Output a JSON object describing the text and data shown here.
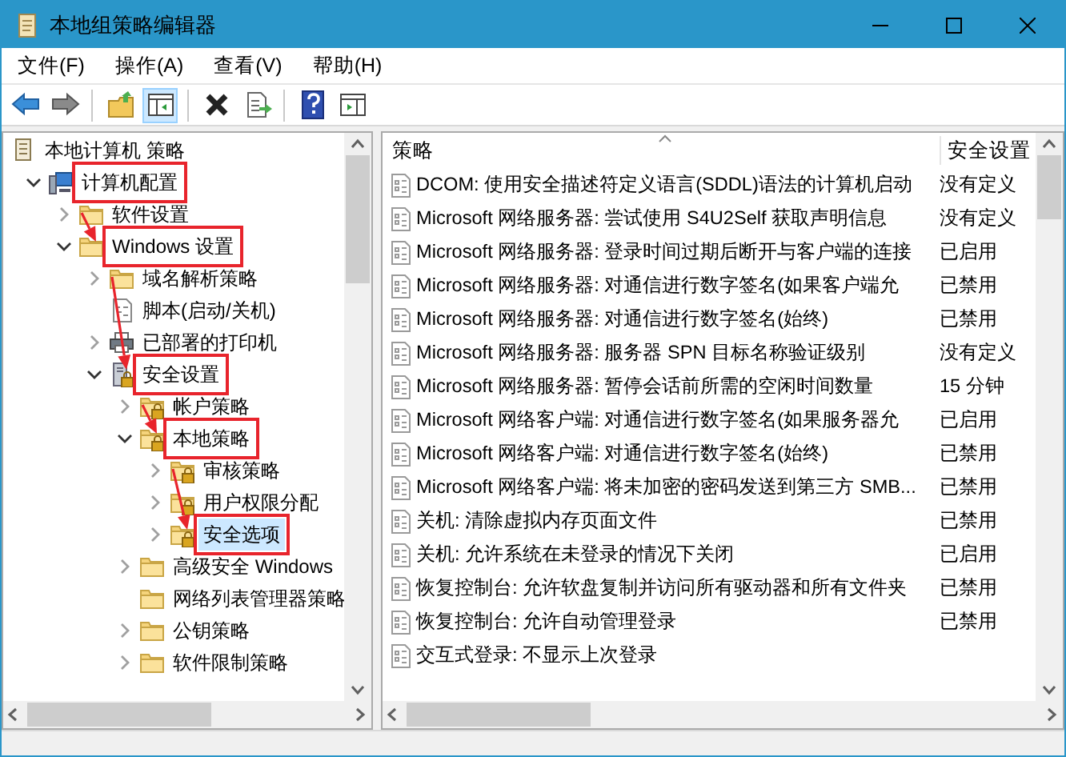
{
  "window": {
    "title": "本地组策略编辑器"
  },
  "menu": [
    "文件(F)",
    "操作(A)",
    "查看(V)",
    "帮助(H)"
  ],
  "toolbar": [
    {
      "kind": "back",
      "pressed": false
    },
    {
      "kind": "forward",
      "pressed": false
    },
    {
      "kind": "sep"
    },
    {
      "kind": "up",
      "pressed": false
    },
    {
      "kind": "tree",
      "pressed": true
    },
    {
      "kind": "sep"
    },
    {
      "kind": "delete",
      "pressed": false
    },
    {
      "kind": "export",
      "pressed": false
    },
    {
      "kind": "sep"
    },
    {
      "kind": "help",
      "pressed": false
    },
    {
      "kind": "pane",
      "pressed": false
    }
  ],
  "tree": [
    {
      "label": "本地计算机 策略",
      "kind": "doc",
      "selected": false,
      "annotated": false,
      "children": [
        {
          "label": "计算机配置",
          "kind": "computer",
          "expanded": true,
          "selected": false,
          "annotated": true,
          "children": [
            {
              "label": "软件设置",
              "kind": "folder",
              "expanded": false,
              "selected": false,
              "annotated": false
            },
            {
              "label": "Windows 设置",
              "kind": "folder",
              "expanded": true,
              "selected": false,
              "annotated": true,
              "children": [
                {
                  "label": "域名解析策略",
                  "kind": "folder",
                  "expanded": false,
                  "selected": false,
                  "annotated": false
                },
                {
                  "label": "脚本(启动/关机)",
                  "kind": "script",
                  "selected": false,
                  "annotated": false
                },
                {
                  "label": "已部署的打印机",
                  "kind": "printer",
                  "expanded": false,
                  "selected": false,
                  "annotated": false
                },
                {
                  "label": "安全设置",
                  "kind": "security",
                  "expanded": true,
                  "selected": false,
                  "annotated": true,
                  "children": [
                    {
                      "label": "帐户策略",
                      "kind": "lockfolder",
                      "expanded": false,
                      "selected": false,
                      "annotated": false
                    },
                    {
                      "label": "本地策略",
                      "kind": "lockfolder",
                      "expanded": true,
                      "selected": false,
                      "annotated": true,
                      "children": [
                        {
                          "label": "审核策略",
                          "kind": "lockfolder",
                          "expanded": false,
                          "selected": false,
                          "annotated": false
                        },
                        {
                          "label": "用户权限分配",
                          "kind": "lockfolder",
                          "expanded": false,
                          "selected": false,
                          "annotated": false
                        },
                        {
                          "label": "安全选项",
                          "kind": "lockfolder",
                          "expanded": false,
                          "selected": true,
                          "annotated": true
                        }
                      ]
                    },
                    {
                      "label": "高级安全 Windows",
                      "kind": "folder",
                      "expanded": false,
                      "selected": false,
                      "annotated": false
                    },
                    {
                      "label": "网络列表管理器策略",
                      "kind": "folder",
                      "selected": false,
                      "annotated": false
                    },
                    {
                      "label": "公钥策略",
                      "kind": "folder",
                      "expanded": false,
                      "selected": false,
                      "annotated": false
                    },
                    {
                      "label": "软件限制策略",
                      "kind": "folder",
                      "expanded": false,
                      "selected": false,
                      "annotated": false
                    }
                  ]
                }
              ]
            }
          ]
        }
      ]
    }
  ],
  "table": {
    "columns": [
      {
        "label": "策略",
        "sorted": true
      },
      {
        "label": "安全设置",
        "sorted": false
      }
    ],
    "rows": [
      {
        "policy": "DCOM: 使用安全描述符定义语言(SDDL)语法的计算机启动",
        "setting": "没有定义"
      },
      {
        "policy": "Microsoft 网络服务器: 尝试使用 S4U2Self 获取声明信息",
        "setting": "没有定义"
      },
      {
        "policy": "Microsoft 网络服务器: 登录时间过期后断开与客户端的连接",
        "setting": "已启用"
      },
      {
        "policy": "Microsoft 网络服务器: 对通信进行数字签名(如果客户端允",
        "setting": "已禁用"
      },
      {
        "policy": "Microsoft 网络服务器: 对通信进行数字签名(始终)",
        "setting": "已禁用"
      },
      {
        "policy": "Microsoft 网络服务器: 服务器 SPN 目标名称验证级别",
        "setting": "没有定义"
      },
      {
        "policy": "Microsoft 网络服务器: 暂停会话前所需的空闲时间数量",
        "setting": "15 分钟"
      },
      {
        "policy": "Microsoft 网络客户端: 对通信进行数字签名(如果服务器允",
        "setting": "已启用"
      },
      {
        "policy": "Microsoft 网络客户端: 对通信进行数字签名(始终)",
        "setting": "已禁用"
      },
      {
        "policy": "Microsoft 网络客户端: 将未加密的密码发送到第三方 SMB...",
        "setting": "已禁用"
      },
      {
        "policy": "关机: 清除虚拟内存页面文件",
        "setting": "已禁用"
      },
      {
        "policy": "关机: 允许系统在未登录的情况下关闭",
        "setting": "已启用"
      },
      {
        "policy": "恢复控制台: 允许软盘复制并访问所有驱动器和所有文件夹",
        "setting": "已禁用"
      },
      {
        "policy": "恢复控制台: 允许自动管理登录",
        "setting": "已禁用"
      },
      {
        "policy": "交互式登录: 不显示上次登录"
      }
    ]
  }
}
